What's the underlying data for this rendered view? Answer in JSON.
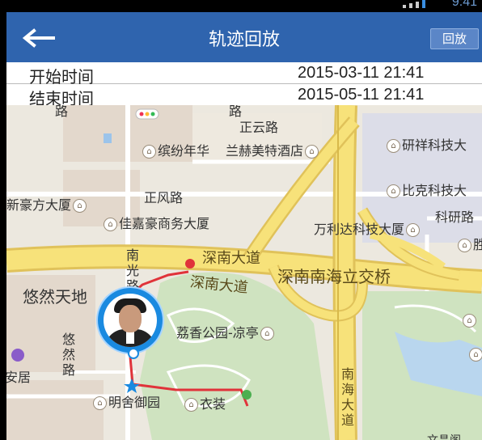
{
  "status_bar": {
    "time": "9:41"
  },
  "header": {
    "back_icon": "arrow-left-icon",
    "title": "轨迹回放",
    "replay_button": "回放"
  },
  "info": {
    "start_label": "开始时间",
    "start_value": "2015-03-11 21:41",
    "end_label": "结束时间",
    "end_value": "2015-05-11 21:41"
  },
  "map": {
    "labels": {
      "lu_top": "路",
      "zhengyun": "正云路",
      "binfen": "缤纷年华",
      "lanhe": "兰赫美特酒店",
      "yanxiang": "研祥科技大",
      "xinhao": "新豪方大厦",
      "zhengfeng": "正风路",
      "bike": "比克科技大",
      "jiajia": "佳嘉豪商务大厦",
      "keyan": "科研路",
      "wanlida": "万利达科技大厦",
      "sheng": "胜",
      "shennan1": "深南大道",
      "shennan2": "深南大道",
      "nanhai_jiao": "深南南海立交桥",
      "nanguang": "南光路",
      "youran": "悠然天地",
      "lixiang": "荔香公园-凉亭",
      "youran_road": "悠然路",
      "anju": "安居",
      "mingshe": "明舍御园",
      "yizhuang": "衣装",
      "nanhai_dadao": "南海大道",
      "wenhua": "文昌阁"
    },
    "route_color": "#e0333a",
    "marker_color": "#1a8ae0"
  }
}
